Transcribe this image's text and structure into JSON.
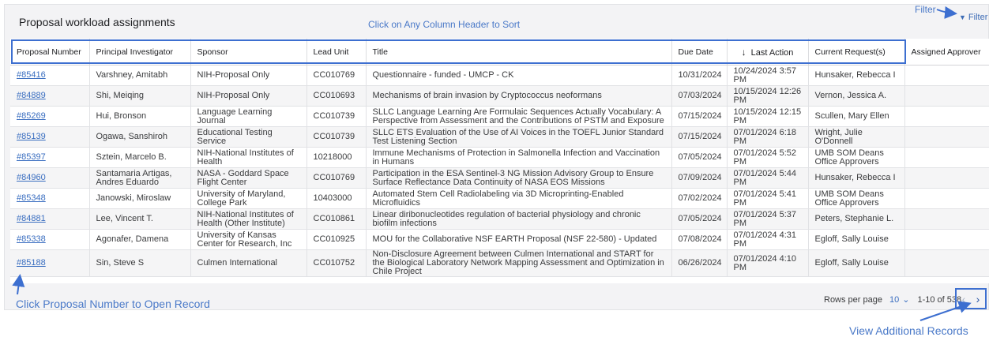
{
  "panel": {
    "title": "Proposal workload assignments"
  },
  "annotations": {
    "sort_hint": "Click on Any Column Header to Sort",
    "filter_hint": "Filter",
    "open_hint": "Click Proposal Number to Open Record",
    "more_hint": "View Additional Records",
    "color": "#4a79c8"
  },
  "filter_button": {
    "label": "Filter",
    "icon": "funnel-icon"
  },
  "table": {
    "columns": [
      "Proposal Number",
      "Principal Investigator",
      "Sponsor",
      "Lead Unit",
      "Title",
      "Due Date",
      "Last Action",
      "Current Request(s)",
      "Assigned Approver"
    ],
    "sorted_column": "Last Action",
    "sort_icon": "arrow-down-icon",
    "rows": [
      [
        "#85416",
        "Varshney, Amitabh",
        "NIH-Proposal Only",
        "CC010769",
        "Questionnaire - funded - UMCP - CK",
        "10/31/2024",
        "10/24/2024 3:57 PM",
        "Hunsaker, Rebecca I",
        ""
      ],
      [
        "#84889",
        "Shi, Meiqing",
        "NIH-Proposal Only",
        "CC010693",
        "Mechanisms of brain invasion by Cryptococcus neoformans",
        "07/03/2024",
        "10/15/2024 12:26 PM",
        "Vernon, Jessica A.",
        ""
      ],
      [
        "#85269",
        "Hui, Bronson",
        "Language Learning Journal",
        "CC010739",
        "SLLC Language Learning Are Formulaic Sequences Actually Vocabulary: A Perspective from Assessment and the Contributions of PSTM and Exposure",
        "07/15/2024",
        "10/15/2024 12:15 PM",
        "Scullen, Mary Ellen",
        ""
      ],
      [
        "#85139",
        "Ogawa, Sanshiroh",
        "Educational Testing Service",
        "CC010739",
        "SLLC ETS Evaluation of the Use of AI Voices in the TOEFL Junior Standard Test Listening Section",
        "07/15/2024",
        "07/01/2024 6:18 PM",
        "Wright, Julie O'Donnell",
        ""
      ],
      [
        "#85397",
        "Sztein, Marcelo B.",
        "NIH-National Institutes of Health",
        "10218000",
        "Immune Mechanisms of Protection in Salmonella Infection and Vaccination in Humans",
        "07/05/2024",
        "07/01/2024 5:52 PM",
        "UMB SOM Deans Office Approvers",
        ""
      ],
      [
        "#84960",
        "Santamaria Artigas, Andres Eduardo",
        "NASA - Goddard Space Flight Center",
        "CC010769",
        "Participation in the ESA Sentinel-3 NG Mission Advisory Group to Ensure Surface Reflectance Data Continuity of NASA EOS Missions",
        "07/09/2024",
        "07/01/2024 5:44 PM",
        "Hunsaker, Rebecca I",
        ""
      ],
      [
        "#85348",
        "Janowski, Miroslaw",
        "University of Maryland, College Park",
        "10403000",
        "Automated Stem Cell Radiolabeling via 3D Microprinting-Enabled Microfluidics",
        "07/02/2024",
        "07/01/2024 5:41 PM",
        "UMB SOM Deans Office Approvers",
        ""
      ],
      [
        "#84881",
        "Lee, Vincent T.",
        "NIH-National Institutes of Health (Other Institute)",
        "CC010861",
        "Linear diribonucleotides regulation of bacterial physiology and chronic biofilm infections",
        "07/05/2024",
        "07/01/2024 5:37 PM",
        "Peters, Stephanie L.",
        ""
      ],
      [
        "#85338",
        "Agonafer, Damena",
        "University of Kansas Center for Research, Inc",
        "CC010925",
        "MOU for the Collaborative NSF EARTH Proposal (NSF 22-580) - Updated",
        "07/08/2024",
        "07/01/2024 4:31 PM",
        "Egloff, Sally Louise",
        ""
      ],
      [
        "#85188",
        "Sin, Steve S",
        "Culmen International",
        "CC010752",
        "Non-Disclosure Agreement between Culmen International and START for the Biological Laboratory Network Mapping Assessment and Optimization in Chile Project",
        "06/26/2024",
        "07/01/2024 4:10 PM",
        "Egloff, Sally Louise",
        ""
      ]
    ]
  },
  "pagination": {
    "rows_per_page_label": "Rows per page",
    "rows_per_page_value": "10",
    "range_text": "1-10 of 538",
    "prev_icon": "chevron-left-icon",
    "next_icon": "chevron-right-icon"
  }
}
